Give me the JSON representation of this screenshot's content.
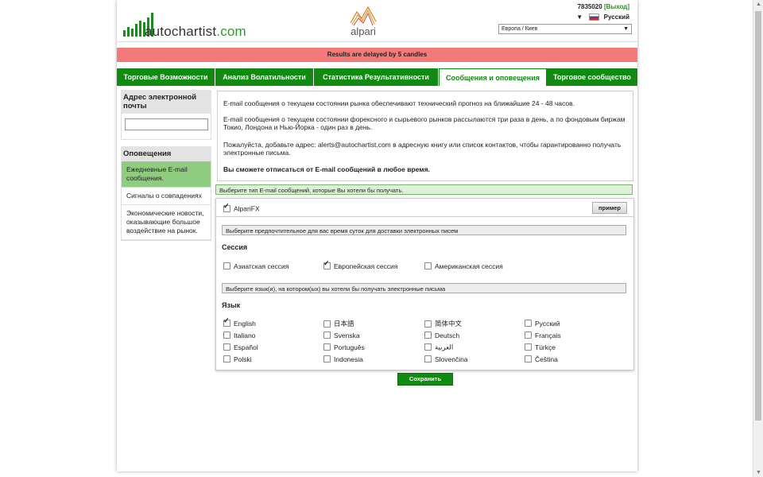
{
  "header": {
    "logo_text": "autochartist",
    "logo_suffix": ".com",
    "partner_name": "alpari",
    "account_id": "7835020",
    "logout_label": "[Выход]",
    "language": "Русский",
    "timezone": "Европа / Киев"
  },
  "banner": {
    "text": "Results are delayed by 5 candles"
  },
  "tabs": [
    {
      "label": "Торговые Возможности"
    },
    {
      "label": "Анализ Волатильности"
    },
    {
      "label": "Статистика Результативности"
    },
    {
      "label": "Сообщения и оповещения"
    },
    {
      "label": "Торговое сообщество"
    }
  ],
  "sidebar": {
    "email_heading": "Адрес электронной почты",
    "email_value": "",
    "alerts_heading": "Оповещения",
    "items": [
      {
        "label": "Ежедневные E-mail сообщения."
      },
      {
        "label": "Сигналы о совпадениях"
      },
      {
        "label": "Экономические новости, оказывающие большое воздействие на рынок."
      }
    ]
  },
  "info": {
    "p1": "E-mail сообщения о текущем состоянии рынка обеспечивают технический прогноз на ближайшие 24 - 48 часов.",
    "p2": "E-mail сообщения о текущем состоянии форексного и сырьевого рынков рассылаются три раза в день, а по фондовым биржам Токио, Лондона и Нью-Йорка - один раз в день.",
    "p3": "Пожалуйста, добавьте адрес: alerts@autochartist.com в адресную книгу или список контактов, чтобы гарантированно получать электронные письма.",
    "p4": "Вы сможете отписаться от E-mail сообщений в любое время."
  },
  "select_type": {
    "text": "Выберите тип E-mail сообщений, которые Вы хотели бы получать."
  },
  "broker": {
    "label": "AlpariFX",
    "checked": true,
    "sample_label": "пример"
  },
  "time_bar": "Выберите предпочтительное для вас время суток для доставки электронных писем",
  "session": {
    "heading": "Сессия",
    "options": [
      {
        "label": "Азиатская сессия",
        "checked": false
      },
      {
        "label": "Европейская сессия",
        "checked": true
      },
      {
        "label": "Американская сессия",
        "checked": false
      }
    ]
  },
  "lang_bar": "Выберите язык(и), на котором(ых) вы хотели бы получать электронные письма",
  "languages": {
    "heading": "Язык",
    "options": [
      {
        "label": "English",
        "checked": true
      },
      {
        "label": "日本語",
        "checked": false
      },
      {
        "label": "简体中文",
        "checked": false
      },
      {
        "label": "Русский",
        "checked": false
      },
      {
        "label": "Italiano",
        "checked": false
      },
      {
        "label": "Svenska",
        "checked": false
      },
      {
        "label": "Deutsch",
        "checked": false
      },
      {
        "label": "Français",
        "checked": false
      },
      {
        "label": "Español",
        "checked": false
      },
      {
        "label": "Português",
        "checked": false
      },
      {
        "label": "العربية",
        "checked": false
      },
      {
        "label": "Türkçe",
        "checked": false
      },
      {
        "label": "Polski",
        "checked": false
      },
      {
        "label": "Indonesia",
        "checked": false
      },
      {
        "label": "Slovenčina",
        "checked": false
      },
      {
        "label": "Čeština",
        "checked": false
      }
    ]
  },
  "save_label": "Сохранить",
  "colors": {
    "tab_green": "#118a11",
    "banner_red": "#f47a7a",
    "active_side": "#90cc80"
  }
}
